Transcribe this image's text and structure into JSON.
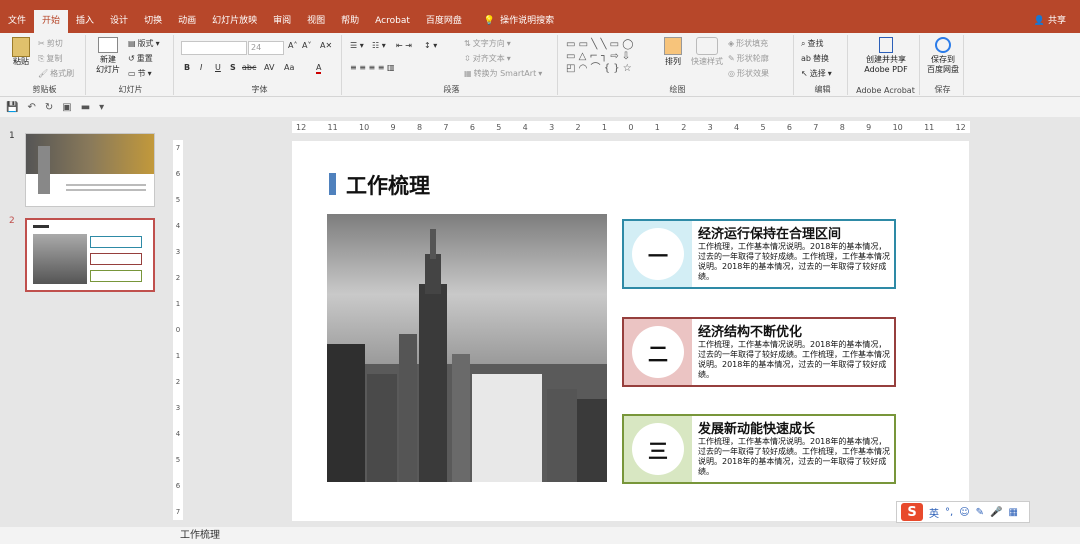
{
  "tabs": [
    "文件",
    "开始",
    "插入",
    "设计",
    "切换",
    "动画",
    "幻灯片放映",
    "审阅",
    "视图",
    "帮助",
    "Acrobat",
    "百度网盘"
  ],
  "active_tab": "开始",
  "tell_me": "操作说明搜索",
  "share": "共享",
  "ribbon": {
    "clipboard": {
      "paste": "粘贴",
      "cut": "剪切",
      "copy": "复制",
      "format_painter": "格式刷",
      "label": "剪贴板"
    },
    "slides": {
      "new_slide_line1": "新建",
      "new_slide_line2": "幻灯片",
      "layout": "版式",
      "reset": "重置",
      "section": "节",
      "label": "幻灯片"
    },
    "font": {
      "size": "24",
      "label": "字体",
      "bold": "B",
      "italic": "I",
      "underline": "U",
      "strike": "S",
      "shadow": "abc",
      "spacing": "AV",
      "case": "Aa",
      "color": "A"
    },
    "paragraph": {
      "text_direction": "文字方向",
      "align_text": "对齐文本",
      "convert_smartart": "转换为 SmartArt",
      "label": "段落"
    },
    "drawing": {
      "arrange": "排列",
      "quick_styles": "快速样式",
      "shape_fill": "形状填充",
      "shape_outline": "形状轮廓",
      "shape_effects": "形状效果",
      "label": "绘图"
    },
    "editing": {
      "find": "查找",
      "replace": "替换",
      "select": "选择",
      "label": "编辑"
    },
    "acrobat": {
      "create_line1": "创建并共享",
      "create_line2": "Adobe PDF",
      "label": "Adobe Acrobat"
    },
    "save": {
      "save_line1": "保存到",
      "save_line2": "百度网盘",
      "label": "保存"
    }
  },
  "thumbnails": [
    {
      "number": "1"
    },
    {
      "number": "2"
    }
  ],
  "ruler_h": [
    "12",
    "11",
    "10",
    "9",
    "8",
    "7",
    "6",
    "5",
    "4",
    "3",
    "2",
    "1",
    "0",
    "1",
    "2",
    "3",
    "4",
    "5",
    "6",
    "7",
    "8",
    "9",
    "10",
    "11",
    "12"
  ],
  "ruler_v": [
    "7",
    "6",
    "5",
    "4",
    "3",
    "2",
    "1",
    "0",
    "1",
    "2",
    "3",
    "4",
    "5",
    "6",
    "7"
  ],
  "slide": {
    "title": "工作梳理",
    "cards": [
      {
        "num": "一",
        "title": "经济运行保持在合理区间",
        "body": "工作梳理，工作基本情况说明。2018年的基本情况，过去的一年取得了较好成绩。工作梳理，工作基本情况说明。2018年的基本情况，过去的一年取得了较好成绩。",
        "border": "#2e8aa6",
        "fill": "#d3eef5"
      },
      {
        "num": "二",
        "title": "经济结构不断优化",
        "body": "工作梳理，工作基本情况说明。2018年的基本情况，过去的一年取得了较好成绩。工作梳理，工作基本情况说明。2018年的基本情况，过去的一年取得了较好成绩。",
        "border": "#963f3d",
        "fill": "#ebc4c3"
      },
      {
        "num": "三",
        "title": "发展新动能快速成长",
        "body": "工作梳理，工作基本情况说明。2018年的基本情况，过去的一年取得了较好成绩。工作梳理，工作基本情况说明。2018年的基本情况，过去的一年取得了较好成绩。",
        "border": "#78963a",
        "fill": "#d8e7c2"
      }
    ]
  },
  "ime": {
    "logo": "S",
    "mode": "英"
  },
  "status": {
    "notes_text": "工作梳理"
  }
}
